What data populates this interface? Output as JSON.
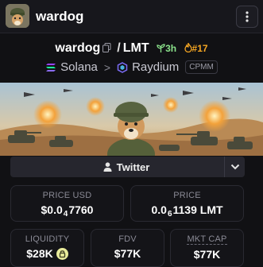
{
  "header": {
    "name": "wardog",
    "menu_icon": "more-vertical-icon"
  },
  "pair": {
    "base": "wardog",
    "separator": "/",
    "quote": "LMT",
    "age": "3h",
    "rank": "#17"
  },
  "chain": {
    "network": "Solana",
    "dex": "Raydium",
    "pool_type": "CPMM"
  },
  "social": {
    "twitter_label": "Twitter"
  },
  "stats": {
    "price_usd_label": "PRICE USD",
    "price_usd_prefix": "$0.0",
    "price_usd_zeros": "4",
    "price_usd_digits": "7760",
    "price_label": "PRICE",
    "price_prefix": "0.0",
    "price_zeros": "6",
    "price_digits": "1139 LMT",
    "liquidity_label": "LIQUIDITY",
    "liquidity_value": "$28K",
    "fdv_label": "FDV",
    "fdv_value": "$77K",
    "mktcap_label": "MKT CAP",
    "mktcap_value": "$77K"
  },
  "colors": {
    "age_green": "#8be28b",
    "rank_orange": "#f5a623",
    "background": "#111114"
  }
}
